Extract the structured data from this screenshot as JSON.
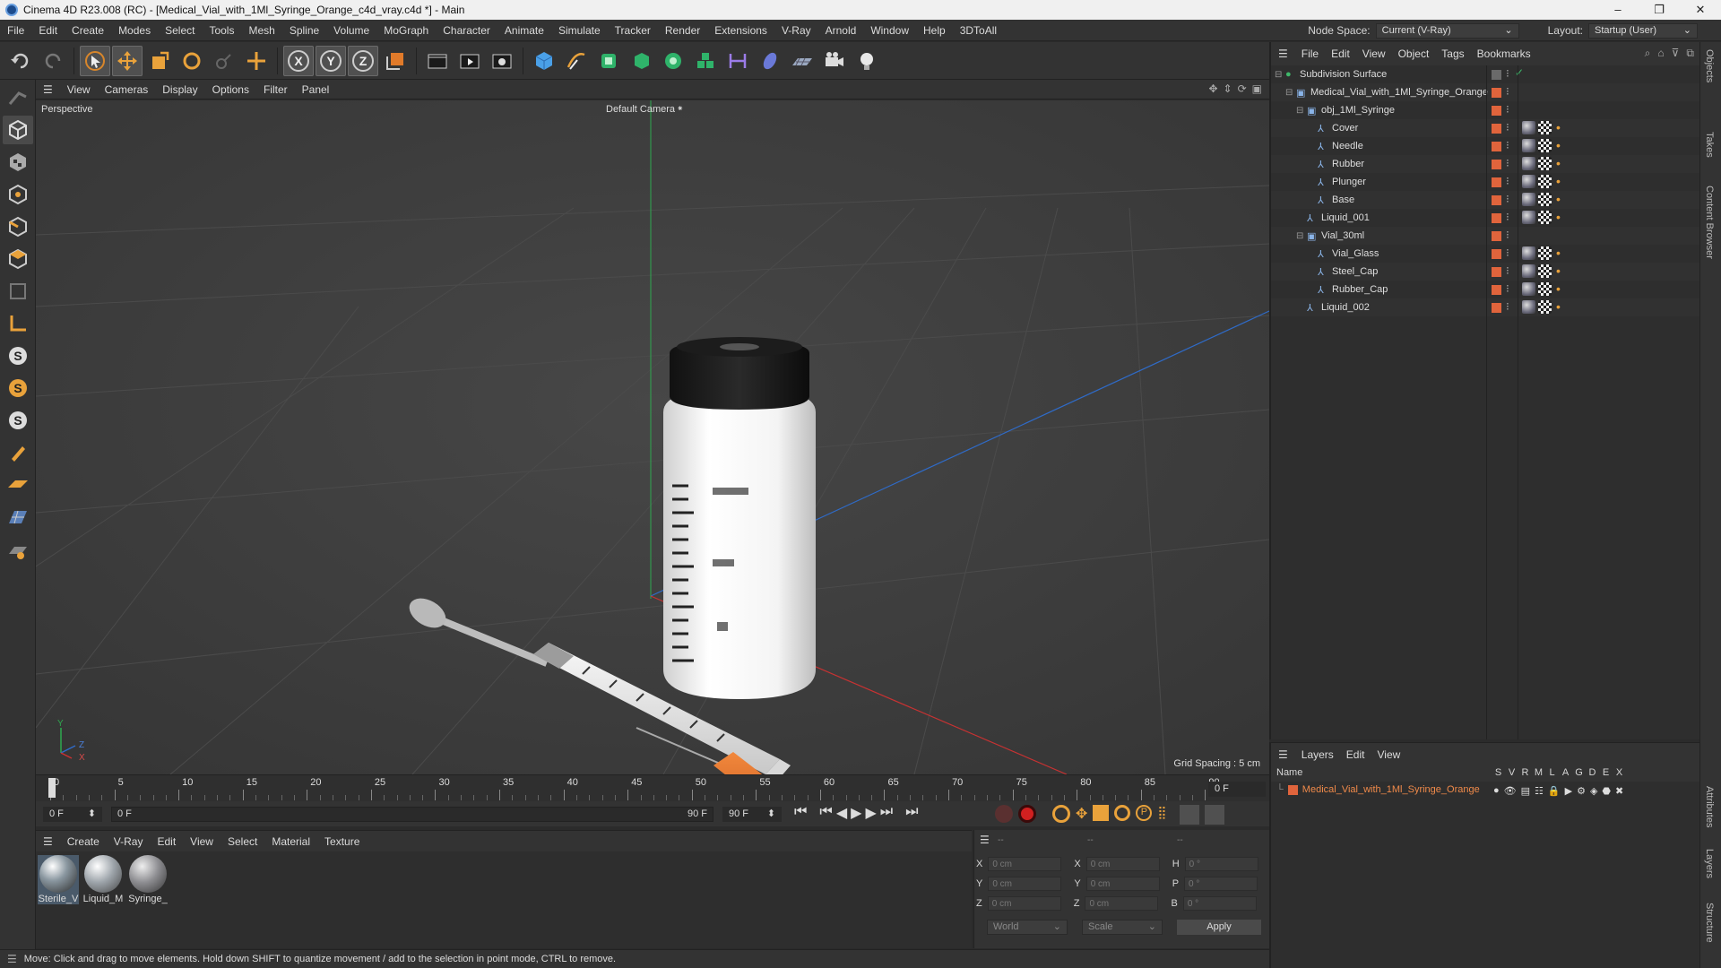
{
  "window": {
    "title": "Cinema 4D R23.008 (RC) - [Medical_Vial_with_1Ml_Syringe_Orange_c4d_vray.c4d *] - Main",
    "min": "–",
    "max": "❐",
    "close": "✕"
  },
  "menu": [
    "File",
    "Edit",
    "Create",
    "Modes",
    "Select",
    "Tools",
    "Mesh",
    "Spline",
    "Volume",
    "MoGraph",
    "Character",
    "Animate",
    "Simulate",
    "Tracker",
    "Render",
    "Extensions",
    "V-Ray",
    "Arnold",
    "Window",
    "Help",
    "3DToAll"
  ],
  "node_space": {
    "label": "Node Space:",
    "value": "Current (V-Ray)"
  },
  "layout": {
    "label": "Layout:",
    "value": "Startup (User)"
  },
  "viewport": {
    "menu": [
      "View",
      "Cameras",
      "Display",
      "Options",
      "Filter",
      "Panel"
    ],
    "name": "Perspective",
    "camera": "Default Camera",
    "grid_spacing": "Grid Spacing : 5 cm",
    "axis": {
      "y": "Y",
      "z": "Z",
      "x": "X"
    }
  },
  "timeline": {
    "ticks": [
      "0",
      "5",
      "10",
      "15",
      "20",
      "25",
      "30",
      "35",
      "40",
      "45",
      "50",
      "55",
      "60",
      "65",
      "70",
      "75",
      "80",
      "85",
      "90"
    ],
    "frame_field": "0 F",
    "start": "0 F",
    "range_start": "0 F",
    "range_end": "90 F",
    "end": "90 F"
  },
  "materials": {
    "menu": [
      "Create",
      "V-Ray",
      "Edit",
      "View",
      "Select",
      "Material",
      "Texture"
    ],
    "items": [
      {
        "label": "Sterile_V",
        "color": "#8a97a0"
      },
      {
        "label": "Liquid_M",
        "color": "#9ea5ab"
      },
      {
        "label": "Syringe_",
        "color": "#8e8e92"
      }
    ]
  },
  "coordinates": {
    "head": [
      "--",
      "--",
      "--"
    ],
    "rows": [
      {
        "a": "X",
        "av": "0 cm",
        "b": "X",
        "bv": "0 cm",
        "c": "H",
        "cv": "0 °"
      },
      {
        "a": "Y",
        "av": "0 cm",
        "b": "Y",
        "bv": "0 cm",
        "c": "P",
        "cv": "0 °"
      },
      {
        "a": "Z",
        "av": "0 cm",
        "b": "Z",
        "bv": "0 cm",
        "c": "B",
        "cv": "0 °"
      }
    ],
    "mode1": "World",
    "mode2": "Scale",
    "apply": "Apply"
  },
  "status": "Move: Click and drag to move elements. Hold down SHIFT to quantize movement / add to the selection in point mode, CTRL to remove.",
  "objects": {
    "menu": [
      "File",
      "Edit",
      "View",
      "Object",
      "Tags",
      "Bookmarks"
    ],
    "rows": [
      {
        "name": "Subdivision Surface",
        "indent": 0,
        "kind": "subdiv"
      },
      {
        "name": "Medical_Vial_with_1Ml_Syringe_Orange",
        "indent": 1,
        "kind": "null"
      },
      {
        "name": "obj_1Ml_Syringe",
        "indent": 2,
        "kind": "null"
      },
      {
        "name": "Cover",
        "indent": 3,
        "kind": "poly"
      },
      {
        "name": "Needle",
        "indent": 3,
        "kind": "poly"
      },
      {
        "name": "Rubber",
        "indent": 3,
        "kind": "poly"
      },
      {
        "name": "Plunger",
        "indent": 3,
        "kind": "poly"
      },
      {
        "name": "Base",
        "indent": 3,
        "kind": "poly"
      },
      {
        "name": "Liquid_001",
        "indent": 2,
        "kind": "poly"
      },
      {
        "name": "Vial_30ml",
        "indent": 2,
        "kind": "null"
      },
      {
        "name": "Vial_Glass",
        "indent": 3,
        "kind": "poly"
      },
      {
        "name": "Steel_Cap",
        "indent": 3,
        "kind": "poly"
      },
      {
        "name": "Rubber_Cap",
        "indent": 3,
        "kind": "poly"
      },
      {
        "name": "Liquid_002",
        "indent": 2,
        "kind": "poly"
      }
    ]
  },
  "layers": {
    "menu": [
      "Layers",
      "Edit",
      "View"
    ],
    "head_name": "Name",
    "head_cols": [
      "S",
      "V",
      "R",
      "M",
      "L",
      "A",
      "G",
      "D",
      "E",
      "X"
    ],
    "item": "Medical_Vial_with_1Ml_Syringe_Orange",
    "item_color": "#e0643c"
  },
  "side_tabs": [
    "Objects",
    "Takes",
    "Content Browser",
    "Attributes",
    "Layers",
    "Structure"
  ]
}
